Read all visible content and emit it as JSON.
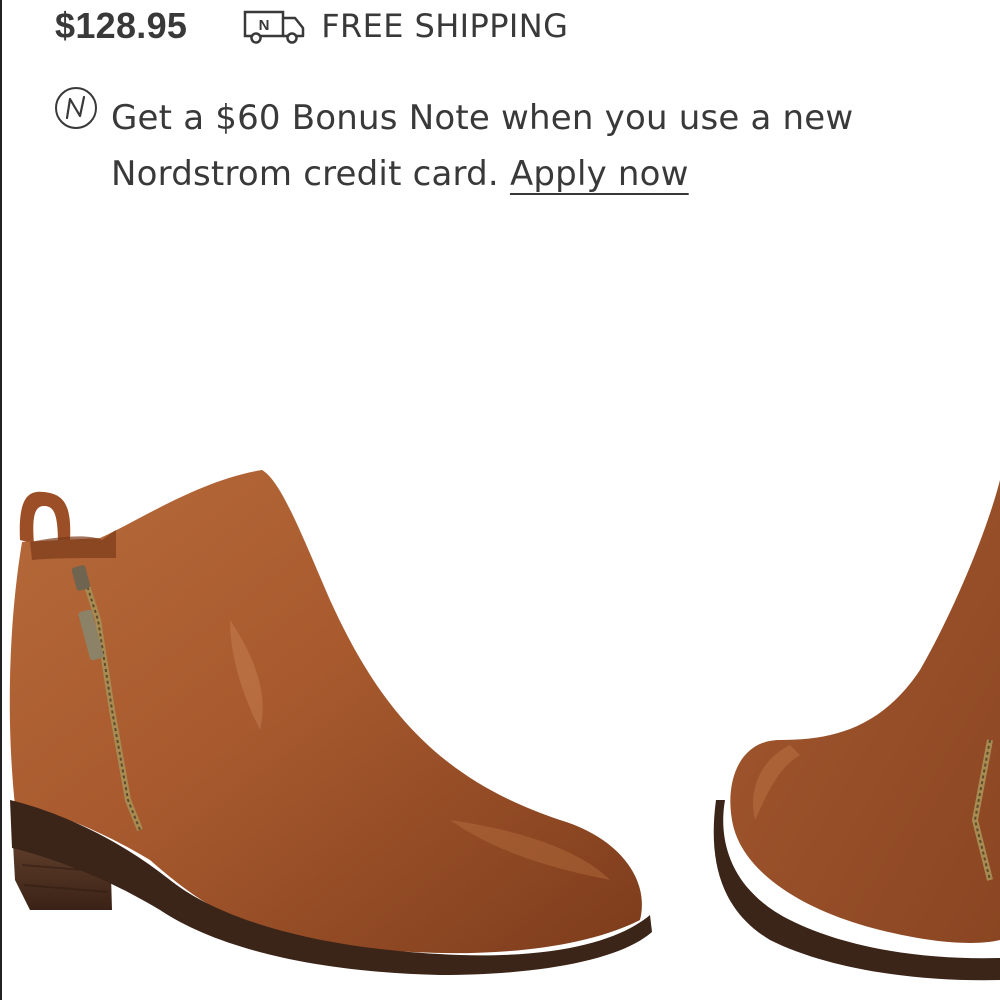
{
  "product": {
    "price": "$128.95",
    "shipping_label": "FREE SHIPPING",
    "shipping_icon": "delivery-truck-icon"
  },
  "promo": {
    "icon": "nordstrom-n-icon",
    "text": "Get a $60 Bonus Note when you use a new Nordstrom credit card.",
    "link_label": "Apply now"
  },
  "image": {
    "subject": "ankle-boots",
    "colors": {
      "leather": "#a85a2e",
      "leather_dark": "#7a3a1a",
      "sole": "#3b2418",
      "heel": "#5a3a26"
    }
  }
}
